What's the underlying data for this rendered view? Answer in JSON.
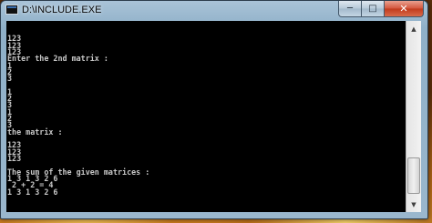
{
  "window": {
    "title": "D:\\INCLUDE.EXE",
    "controls": {
      "minimize": "─",
      "maximize": "□",
      "close": "✕"
    }
  },
  "console": {
    "lines": [
      "",
      "123",
      "123",
      "123",
      "Enter the 2nd matrix :",
      "1",
      "2",
      "3",
      "",
      "1",
      "2",
      "3",
      "1",
      "2",
      "3",
      "the matrix :",
      "",
      "123",
      "123",
      "123",
      "",
      "The sum of the given matrices :",
      "1 3 1 3 2 6",
      " 2 + 2 = 4",
      "1 3 1 3 2 6"
    ]
  },
  "scrollbar": {
    "up_icon": "▲",
    "down_icon": "▼"
  }
}
